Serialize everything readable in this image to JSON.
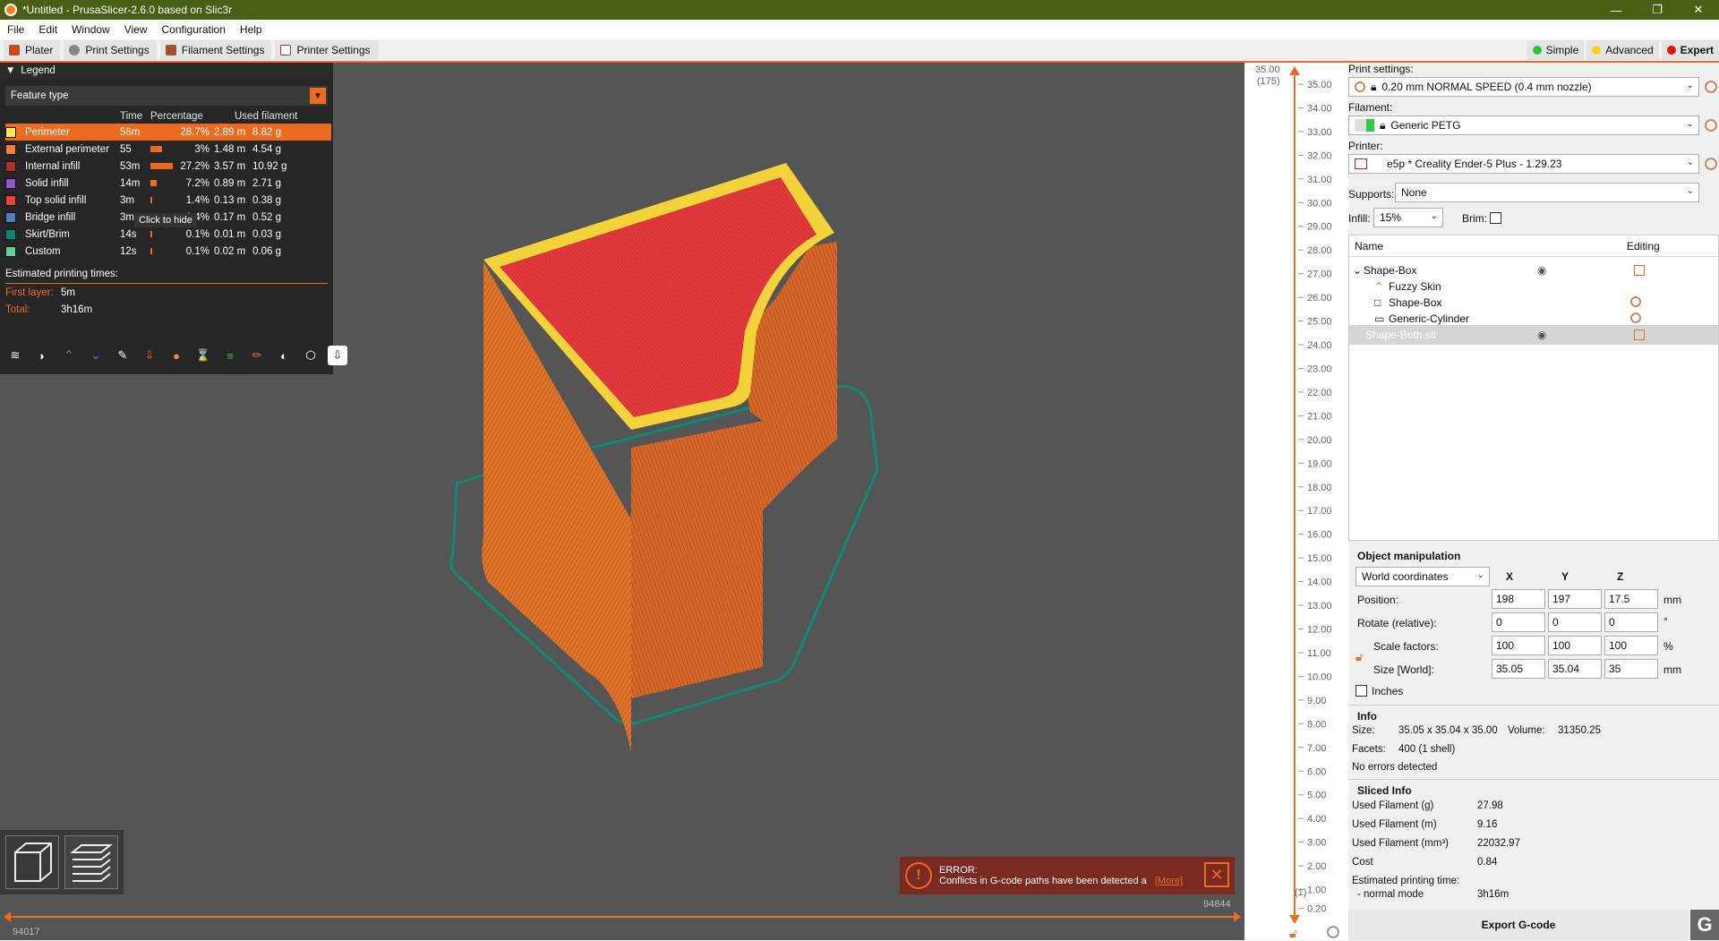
{
  "window": {
    "title": "*Untitled - PrusaSlicer-2.6.0 based on Slic3r",
    "min": "—",
    "max": "❐",
    "close": "✕"
  },
  "menu": [
    "File",
    "Edit",
    "Window",
    "View",
    "Configuration",
    "Help"
  ],
  "tabs": [
    "Plater",
    "Print Settings",
    "Filament Settings",
    "Printer Settings"
  ],
  "modes": [
    {
      "label": "Simple",
      "color": "#31c32f"
    },
    {
      "label": "Advanced",
      "color": "#f7d21c"
    },
    {
      "label": "Expert",
      "color": "#e50f0f"
    }
  ],
  "legend": {
    "title": "Legend",
    "view_type": "Feature type",
    "col_time": "Time",
    "col_percentage": "Percentage",
    "col_used": "Used filament",
    "rows": [
      {
        "name": "Perimeter",
        "time": "56m",
        "pct": "28.7%",
        "pct_value": 28.7,
        "len": "2.89 m",
        "wt": "8.82 g",
        "color": "#ffe74a",
        "selected": true
      },
      {
        "name": "External perimeter",
        "time": "55",
        "pct": "3%",
        "pct_value": 14.9,
        "len": "1.48 m",
        "wt": "4.54 g",
        "color": "#ff7d38"
      },
      {
        "name": "Internal infill",
        "time": "53m",
        "pct": "27.2%",
        "pct_value": 27.2,
        "len": "3.57 m",
        "wt": "10.92 g",
        "color": "#b03029"
      },
      {
        "name": "Solid infill",
        "time": "14m",
        "pct": "7.2%",
        "pct_value": 7.2,
        "len": "0.89 m",
        "wt": "2.71 g",
        "color": "#9654cc"
      },
      {
        "name": "Top solid infill",
        "time": "3m",
        "pct": "1.4%",
        "pct_value": 1.4,
        "len": "0.13 m",
        "wt": "0.38 g",
        "color": "#f04040"
      },
      {
        "name": "Bridge infill",
        "time": "3m",
        "pct": "1.4%",
        "pct_value": 1.4,
        "len": "0.17 m",
        "wt": "0.52 g",
        "color": "#4d80ba"
      },
      {
        "name": "Skirt/Brim",
        "time": "14s",
        "pct": "0.1%",
        "pct_value": 0.1,
        "len": "0.01 m",
        "wt": "0.03 g",
        "color": "#00876e"
      },
      {
        "name": "Custom",
        "time": "12s",
        "pct": "0.1%",
        "pct_value": 0.1,
        "len": "0.02 m",
        "wt": "0.06 g",
        "color": "#5ed194"
      }
    ],
    "tooltip": "Click to hide",
    "est_title": "Estimated printing times:",
    "first_layer_label": "First layer:",
    "first_layer": "5m",
    "total_label": "Total:",
    "total": "3h16m"
  },
  "slider": {
    "h_left": "94017",
    "h_right": "94844",
    "v_top": "35.00",
    "v_top_layer": "(175)",
    "v_bottom": "(1)",
    "ticks": [
      "35.00",
      "34.00",
      "33.00",
      "32.00",
      "31.00",
      "30.00",
      "29.00",
      "28.00",
      "27.00",
      "26.00",
      "25.00",
      "24.00",
      "23.00",
      "22.00",
      "21.00",
      "20.00",
      "19.00",
      "18.00",
      "17.00",
      "16.00",
      "15.00",
      "14.00",
      "13.00",
      "12.00",
      "11.00",
      "10.00",
      "9.00",
      "8.00",
      "7.00",
      "6.00",
      "5.00",
      "4.00",
      "3.00",
      "2.00",
      "1.00",
      "0.20"
    ]
  },
  "error": {
    "title": "ERROR:",
    "message": "Conflicts in G-code paths have been detected a",
    "more": "[More]"
  },
  "sidebar": {
    "print_settings_label": "Print settings:",
    "print_settings_value": "0.20 mm NORMAL SPEED (0.4 mm nozzle)",
    "filament_label": "Filament:",
    "filament_value": "Generic PETG",
    "printer_label": "Printer:",
    "printer_value": "e5p * Creality Ender-5 Plus - 1.29.23",
    "supports_label": "Supports:",
    "supports_value": "None",
    "infill_label": "Infill:",
    "infill_value": "15%",
    "brim_label": "Brim:",
    "list_name": "Name",
    "list_editing": "Editing",
    "objects": [
      {
        "label": "Shape-Box",
        "indent": 0,
        "expanded": true
      },
      {
        "label": "Fuzzy Skin",
        "indent": 1
      },
      {
        "label": "Shape-Box",
        "indent": 1
      },
      {
        "label": "Generic-Cylinder",
        "indent": 1
      },
      {
        "label": "Shape-Both.stl",
        "indent": 0,
        "selected": true
      }
    ],
    "om_title": "Object manipulation",
    "coords": "World coordinates",
    "x": "X",
    "y": "Y",
    "z": "Z",
    "position_label": "Position:",
    "position": [
      "198",
      "197",
      "17.5"
    ],
    "rotate_label": "Rotate (relative):",
    "rotate": [
      "0",
      "0",
      "0"
    ],
    "scale_label": "Scale factors:",
    "scale": [
      "100",
      "100",
      "100"
    ],
    "size_label": "Size [World]:",
    "size": [
      "35.05",
      "35.04",
      "35"
    ],
    "unit_mm": "mm",
    "unit_deg": "°",
    "unit_pct": "%",
    "inches_label": "Inches",
    "info_title": "Info",
    "info_size_label": "Size:",
    "info_size": "35.05 x 35.04 x 35.00",
    "info_volume_label": "Volume:",
    "info_volume": "31350.25",
    "info_facets_label": "Facets:",
    "info_facets": "400 (1 shell)",
    "info_errors": "No errors detected",
    "sliced_title": "Sliced Info",
    "sliced": [
      {
        "k": "Used Filament (g)",
        "v": "27.98"
      },
      {
        "k": "Used Filament (m)",
        "v": "9.16"
      },
      {
        "k": "Used Filament (mm³)",
        "v": "22032.97"
      },
      {
        "k": "Cost",
        "v": "0.84"
      }
    ],
    "est_label": "Estimated printing time:",
    "normal_mode_label": "- normal mode",
    "normal_mode": "3h16m",
    "export": "Export G-code",
    "g_logo": "G"
  }
}
